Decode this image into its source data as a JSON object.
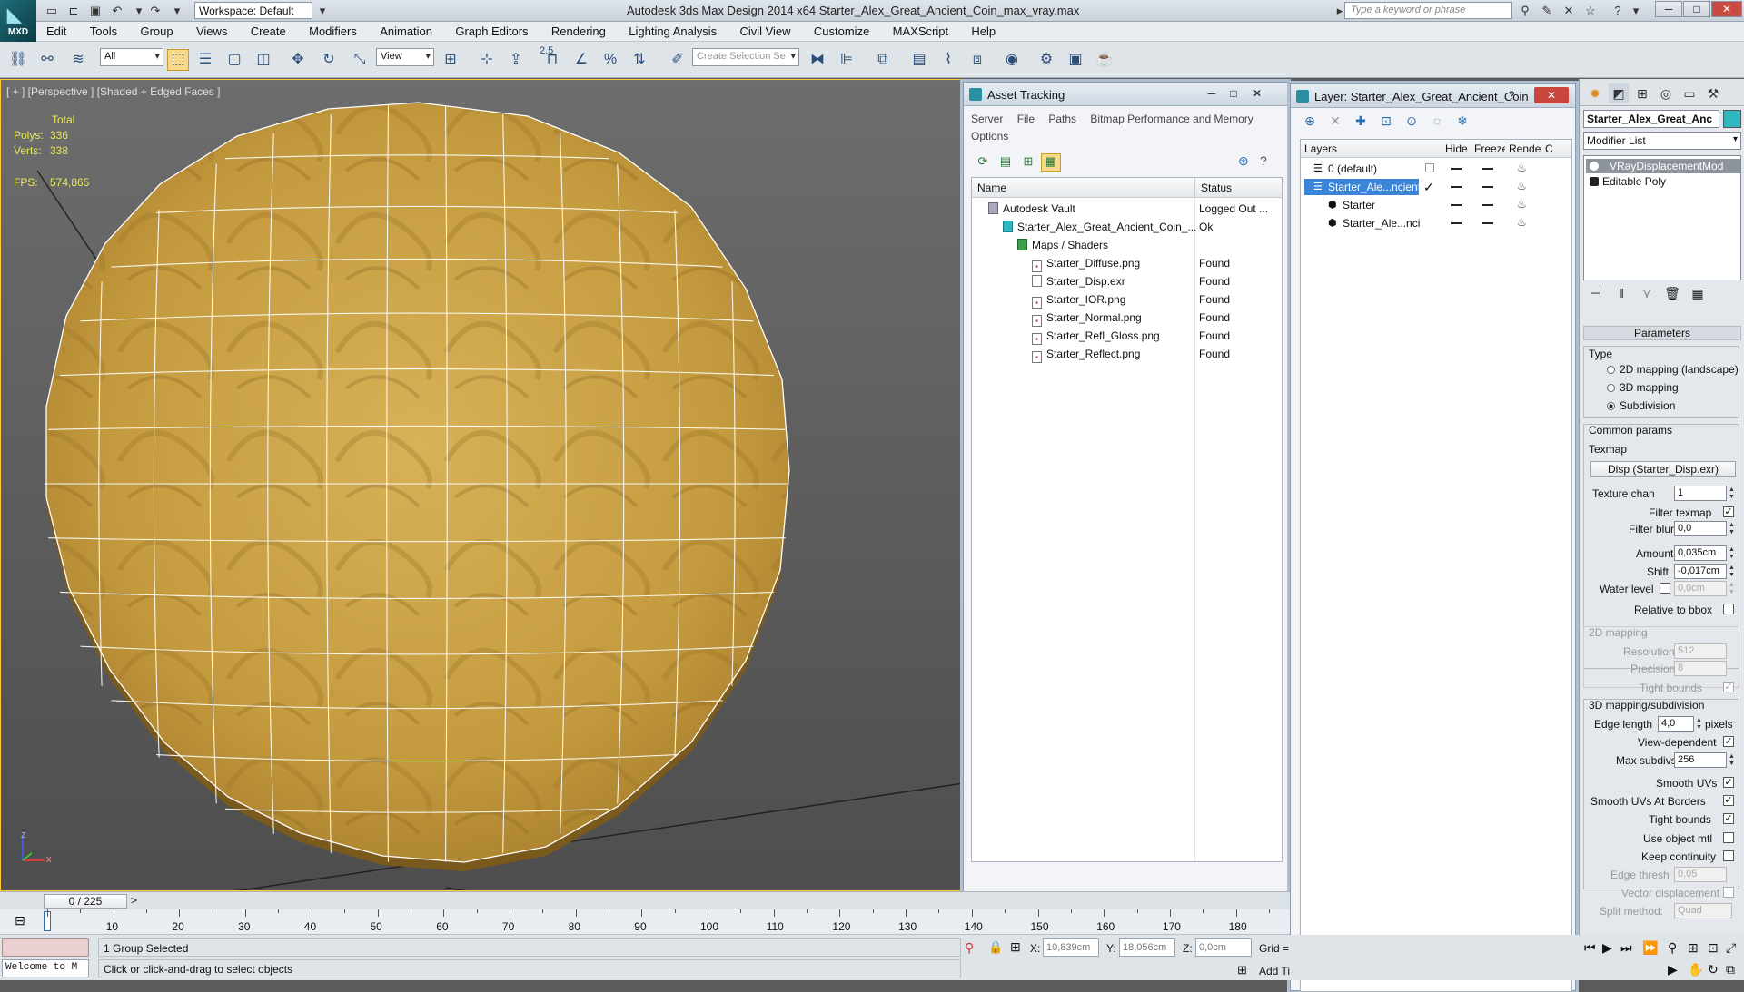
{
  "app": {
    "logo_text": "MXD",
    "title": "Autodesk 3ds Max Design 2014 x64    Starter_Alex_Great_Ancient_Coin_max_vray.max",
    "workspace": "Workspace: Default",
    "search_placeholder": "Type a keyword or phrase"
  },
  "menu": [
    "Edit",
    "Tools",
    "Group",
    "Views",
    "Create",
    "Modifiers",
    "Animation",
    "Graph Editors",
    "Rendering",
    "Lighting Analysis",
    "Civil View",
    "Customize",
    "MAXScript",
    "Help"
  ],
  "toolbar": {
    "selection_filter": "All",
    "ref_coord": "View",
    "snap_value": "2.5",
    "named_selection_placeholder": "Create Selection Se"
  },
  "viewport": {
    "label": "[ + ] [Perspective ] [Shaded + Edged Faces ]",
    "stats_header": "Total",
    "stats": [
      {
        "key": "Polys:",
        "value": "336"
      },
      {
        "key": "Verts:",
        "value": "338"
      }
    ],
    "fps_key": "FPS:",
    "fps_value": "574,865",
    "axis_z": "z",
    "axis_x": "x",
    "colors": {
      "coin_base": "#c9a040",
      "coin_dark": "#8a6520",
      "wire": "#ffffff"
    }
  },
  "asset_tracking": {
    "title": "Asset Tracking",
    "menu": [
      "Server",
      "File",
      "Paths",
      "Bitmap Performance and Memory",
      "Options"
    ],
    "columns": {
      "name": "Name",
      "status": "Status"
    },
    "rows": [
      {
        "name": "Autodesk Vault",
        "status": "Logged Out ..."
      },
      {
        "name": "Starter_Alex_Great_Ancient_Coin_...",
        "status": "Ok"
      },
      {
        "name": "Maps / Shaders",
        "status": ""
      },
      {
        "name": "Starter_Diffuse.png",
        "status": "Found"
      },
      {
        "name": "Starter_Disp.exr",
        "status": "Found"
      },
      {
        "name": "Starter_IOR.png",
        "status": "Found"
      },
      {
        "name": "Starter_Normal.png",
        "status": "Found"
      },
      {
        "name": "Starter_Refl_Gloss.png",
        "status": "Found"
      },
      {
        "name": "Starter_Reflect.png",
        "status": "Found"
      }
    ]
  },
  "layer_manager": {
    "title": "Layer: Starter_Alex_Great_Ancient_Coin",
    "columns": {
      "layers": "Layers",
      "hide": "Hide",
      "freeze": "Freeze",
      "render": "Render",
      "extra": "C"
    },
    "rows": [
      {
        "name": "0 (default)"
      },
      {
        "name": "Starter_Ale...ncient"
      },
      {
        "name": "Starter"
      },
      {
        "name": "Starter_Ale...nci"
      }
    ]
  },
  "command_panel": {
    "object_name": "Starter_Alex_Great_Anc",
    "object_color": "#2fb7c0",
    "modifier_list": "Modifier List",
    "stack": [
      "VRayDisplacementMod",
      "Editable Poly"
    ],
    "rollout": "Parameters",
    "type_label": "Type",
    "type_options": [
      "2D mapping (landscape)",
      "3D mapping",
      "Subdivision"
    ],
    "common_label": "Common params",
    "texmap_label": "Texmap",
    "texmap_button": "Disp (Starter_Disp.exr)",
    "texture_chan_label": "Texture chan",
    "texture_chan": "1",
    "filter_texmap_label": "Filter texmap",
    "filter_blur_label": "Filter blur",
    "filter_blur": "0,0",
    "amount_label": "Amount",
    "amount": "0,035cm",
    "shift_label": "Shift",
    "shift": "-0,017cm",
    "water_label": "Water level",
    "water": "0,0cm",
    "relative_label": "Relative to bbox",
    "map2d_label": "2D mapping",
    "resolution_label": "Resolution",
    "resolution": "512",
    "precision_label": "Precision",
    "precision": "8",
    "tight_label": "Tight bounds",
    "map3d_label": "3D mapping/subdivision",
    "edge_length_label": "Edge length",
    "edge_length": "4,0",
    "pixels_label": "pixels",
    "view_dep_label": "View-dependent",
    "max_subdivs_label": "Max subdivs",
    "max_subdivs": "256",
    "smooth_uvs_label": "Smooth UVs",
    "smooth_uvs_borders_label": "Smooth UVs At Borders",
    "tight_bounds_label": "Tight bounds",
    "use_obj_mtl_label": "Use object mtl",
    "keep_cont_label": "Keep continuity",
    "edge_thresh_label": "Edge thresh",
    "edge_thresh": "0,05",
    "vector_disp_label": "Vector displacement",
    "split_label": "Split method:",
    "split": "Quad"
  },
  "timeline": {
    "frame": "0 / 225",
    "ticks": [
      "10",
      "20",
      "30",
      "40",
      "50",
      "60",
      "70",
      "80",
      "90",
      "100",
      "110",
      "120",
      "130",
      "140",
      "150",
      "160",
      "170",
      "180"
    ]
  },
  "status": {
    "maxscript": "Welcome to M",
    "selection": "1 Group Selected",
    "prompt": "Click or click-and-drag to select objects",
    "x_label": "X:",
    "x": "10,839cm",
    "y_label": "Y:",
    "y": "18,056cm",
    "z_label": "Z:",
    "z": "0,0cm",
    "grid": "Grid =",
    "add_time_tag": "Add Ti"
  }
}
